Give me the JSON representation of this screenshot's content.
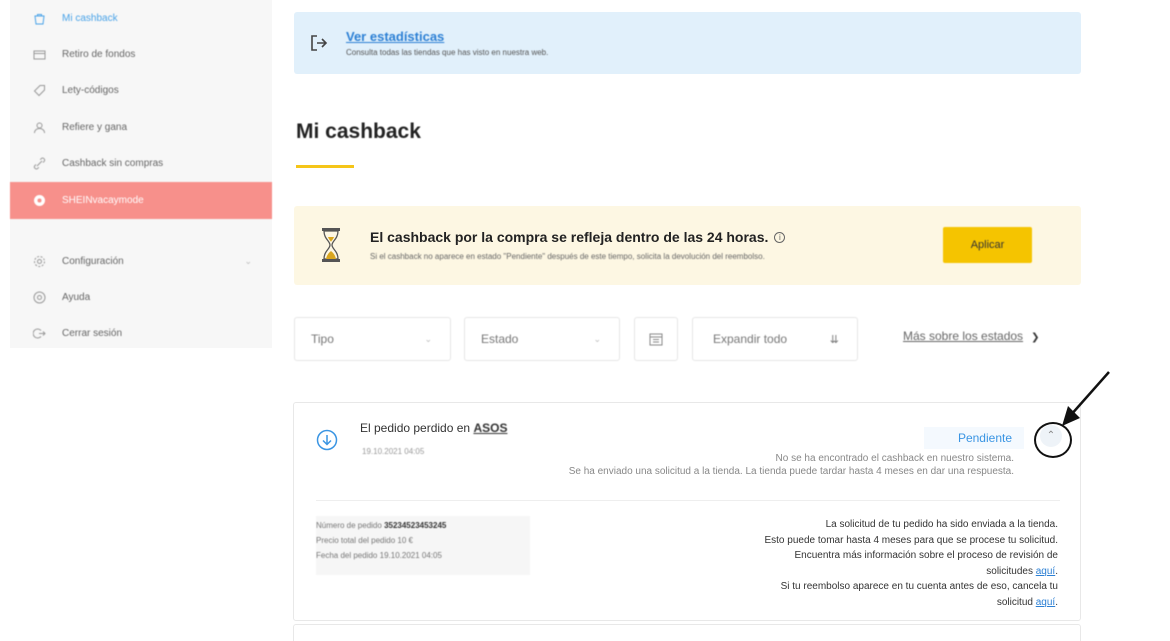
{
  "sidebar": {
    "items": [
      {
        "label": "Mi cashback",
        "icon": "bag-icon"
      },
      {
        "label": "Retiro de fondos",
        "icon": "wallet-icon"
      },
      {
        "label": "Lety-códigos",
        "icon": "tag-icon"
      },
      {
        "label": "Refiere y gana",
        "icon": "user-icon"
      },
      {
        "label": "Cashback sin compras",
        "icon": "link-icon"
      },
      {
        "label": "SHEINvacaymode",
        "icon": "promo-icon"
      },
      {
        "label": "Configuración",
        "icon": "gear-icon"
      },
      {
        "label": "Ayuda",
        "icon": "help-icon"
      },
      {
        "label": "Cerrar sesión",
        "icon": "logout-icon"
      }
    ],
    "colors": {
      "active": "#4aa3e8",
      "promo_bg": "#f7908b"
    }
  },
  "stats_banner": {
    "link": "Ver estadísticas",
    "subtitle": "Consulta todas las tiendas que has visto en nuestra web."
  },
  "page": {
    "title": "Mi cashback"
  },
  "notice": {
    "title": "El cashback por la compra se refleja dentro de las 24 horas.",
    "body": "Si el cashback no aparece en estado \"Pendiente\" después de este tiempo, solicita la devolución del reembolso.",
    "button": "Aplicar"
  },
  "filters": {
    "type": "Tipo",
    "state": "Estado",
    "expand": "Expandir todo",
    "states_link": "Más sobre los estados"
  },
  "order": {
    "title_prefix": "El pedido perdido en",
    "store": "ASOS",
    "date": "19.10.2021 04:05",
    "status": "Pendiente",
    "status_msg_1": "No se ha encontrado el cashback en nuestro sistema.",
    "status_msg_2": "Se ha enviado una solicitud a la tienda. La tienda puede tardar hasta 4 meses en dar una respuesta.",
    "details": {
      "order_number_label": "Número de pedido",
      "order_number": "35234523453245",
      "total_label": "Precio total del pedido",
      "total": "10 €",
      "date_label": "Fecha del pedido",
      "date": "19.10.2021 04:05"
    },
    "info": {
      "line1": "La solicitud de tu pedido ha sido enviada a la tienda.",
      "line2": "Esto puede tomar hasta 4 meses para que se procese tu solicitud.",
      "line3": "Encuentra más información sobre el proceso de revisión de",
      "line4": "solicitudes",
      "link1": "aquí",
      "line5": "Si tu reembolso aparece en tu cuenta antes de eso, cancela tu",
      "line6": "solicitud",
      "link2": "aquí"
    }
  }
}
